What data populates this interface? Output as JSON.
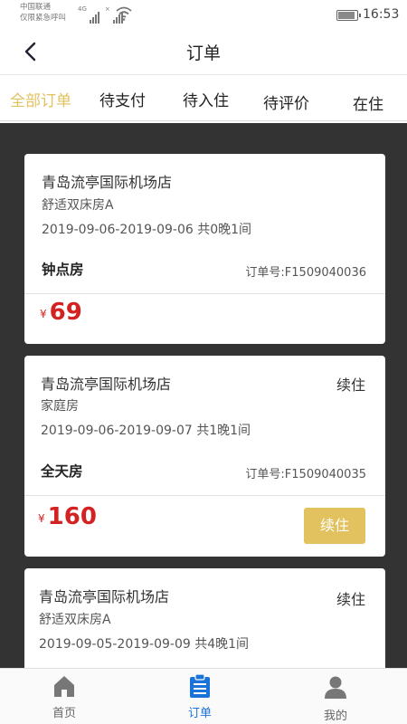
{
  "status_bar": {
    "carrier_line1": "中国联通",
    "carrier_line2": "仅限紧急呼叫",
    "network_tag_1": "4G",
    "network_tag_2": "×",
    "time": "16:53",
    "battery_level": 0.8
  },
  "header": {
    "title": "订单"
  },
  "tabs": [
    {
      "label": "全部订单",
      "active": true
    },
    {
      "label": "待支付",
      "active": false
    },
    {
      "label": "待入住",
      "active": false
    },
    {
      "label": "待评价",
      "active": false
    },
    {
      "label": "在住",
      "active": false
    }
  ],
  "orders": [
    {
      "hotel": "青岛流亭国际机场店",
      "room": "舒适双床房A",
      "dates": "2019-09-06-2019-09-06 共0晚1间",
      "type": "钟点房",
      "order_no": "订单号:F1509040036",
      "currency": "¥",
      "price": "69"
    },
    {
      "hotel": "青岛流亭国际机场店",
      "room": "家庭房",
      "dates": "2019-09-06-2019-09-07 共1晚1间",
      "type": "全天房",
      "order_no": "订单号:F1509040035",
      "currency": "¥",
      "price": "160",
      "renew_link": "续住",
      "renew_button": "续住"
    },
    {
      "hotel": "青岛流亭国际机场店",
      "room": "舒适双床房A",
      "dates": "2019-09-05-2019-09-09 共4晚1间",
      "renew_link": "续住"
    }
  ],
  "bottom_nav": [
    {
      "label": "首页",
      "icon": "home-icon"
    },
    {
      "label": "订单",
      "icon": "order-icon",
      "active": true
    },
    {
      "label": "我的",
      "icon": "user-icon"
    }
  ],
  "colors": {
    "accent_gold": "#e2c25f",
    "price_red": "#d42222",
    "active_blue": "#1a73d9",
    "list_background": "#333333"
  }
}
